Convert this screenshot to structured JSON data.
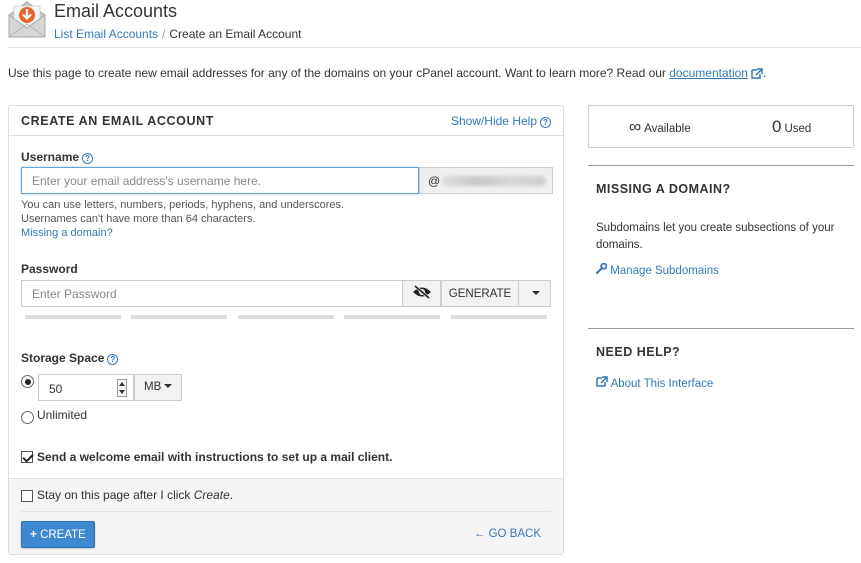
{
  "header": {
    "title": "Email Accounts",
    "breadcrumb": {
      "parent": "List Email Accounts",
      "current": "Create an Email Account"
    }
  },
  "intro": {
    "text": "Use this page to create new email addresses for any of the domains on your cPanel account. Want to learn more? Read our ",
    "link": "documentation",
    "suffix": "."
  },
  "form": {
    "title": "CREATE AN EMAIL ACCOUNT",
    "help_toggle": "Show/Hide Help",
    "username": {
      "label": "Username",
      "placeholder": "Enter your email address's username here.",
      "domain_prefix": "@",
      "help_line1": "You can use letters, numbers, periods, hyphens, and underscores.",
      "help_line2": "Usernames can't have more than 64 characters.",
      "missing_domain_link": "Missing a domain?"
    },
    "password": {
      "label": "Password",
      "placeholder": "Enter Password",
      "generate_label": "GENERATE"
    },
    "storage": {
      "label": "Storage Space",
      "value": "50",
      "unit": "MB",
      "unlimited_label": "Unlimited",
      "selected": "custom"
    },
    "welcome_email": {
      "label": "Send a welcome email with instructions to set up a mail client.",
      "checked": true
    },
    "stay_on_page": {
      "label_prefix": "Stay on this page after I click ",
      "label_emph": "Create",
      "label_suffix": ".",
      "checked": false
    },
    "create_label": "CREATE",
    "go_back_label": "GO BACK"
  },
  "sidebar": {
    "available_value": "∞",
    "available_label": "Available",
    "used_value": "0",
    "used_label": "Used",
    "missing_domain": {
      "title": "MISSING A DOMAIN?",
      "text": "Subdomains let you create subsections of your domains.",
      "link": "Manage Subdomains"
    },
    "need_help": {
      "title": "NEED HELP?",
      "link": "About This Interface"
    }
  },
  "colors": {
    "link": "#3478b7",
    "primary_button": "#3e88cf",
    "envelope_accent": "#e8652a"
  }
}
